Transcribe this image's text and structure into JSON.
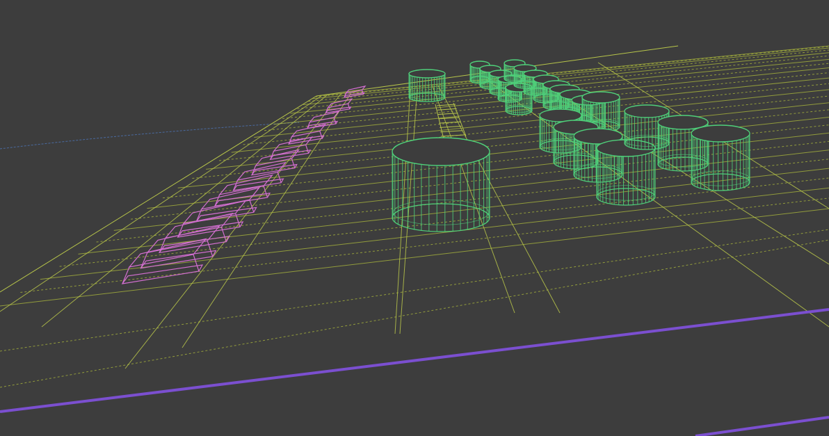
{
  "viewport": {
    "mode": "wireframe",
    "background": "#3d3d3d"
  },
  "colors": {
    "board_edges": "#b8c64a",
    "board_grid": "#a8b43c",
    "keys": "#d36fd0",
    "knobs": "#4fd07a",
    "selection_edge": "#7b4fd0",
    "horizon_line": "#4a6aa0"
  },
  "scene": {
    "objects": [
      {
        "type": "board",
        "name": "control-surface-board"
      },
      {
        "type": "key-row",
        "name": "pink-key-row",
        "count": 13
      },
      {
        "type": "knob",
        "name": "large-knob"
      },
      {
        "type": "knob-grid",
        "name": "green-knob-grid",
        "count": 20
      },
      {
        "type": "fader",
        "name": "center-fader-track"
      }
    ]
  }
}
